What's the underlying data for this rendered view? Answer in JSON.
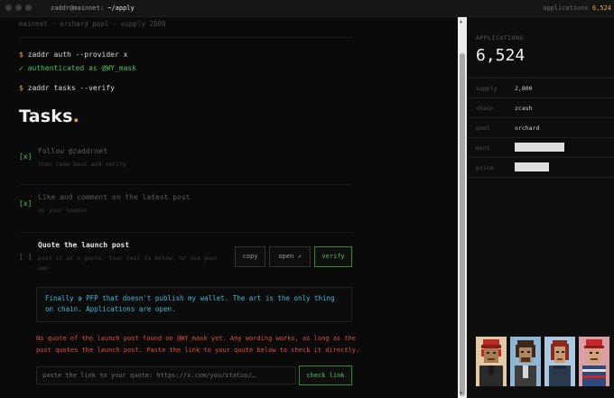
{
  "window": {
    "title_user": "zaddr@mainnet:",
    "title_path": "~/apply",
    "apps_label": "applications",
    "apps_count": "6,524"
  },
  "breadcrumb": "mainnet · orchard pool · supply 2800",
  "terminal": {
    "cmd1": "zaddr auth --provider x",
    "auth_ok": "✓ authenticated as @WY_mask",
    "cmd2": "zaddr tasks --verify",
    "prompt": "$"
  },
  "heading": {
    "text": "Tasks",
    "dot": "."
  },
  "tasks": [
    {
      "check": "[x]",
      "title": "Follow @zaddrnet",
      "sub": "then come back and verify"
    },
    {
      "check": "[x]",
      "title": "Like and comment on the latest post",
      "sub": "on your honour"
    },
    {
      "check": "[ ]",
      "title": "Quote the launch post",
      "sub": "post it as a quote. Your text is below, or use your own"
    }
  ],
  "buttons": {
    "copy": "copy",
    "open": "open ↗",
    "verify": "verify",
    "check_link": "check link"
  },
  "quote_text": "Finally a PFP that doesn't publish my wallet. The art is the only thing on chain. Applications are open.",
  "warning": "No quote of the launch post found on @WY_mask yet. Any wording works, as long as the post quotes the launch post. Paste the link to your quote below to check it directly.",
  "link_input": {
    "placeholder": "paste the link to your quote: https://x.com/you/status/…"
  },
  "stats": {
    "label": "APPLICATIONS",
    "value": "6,524",
    "rows": [
      {
        "key": "supply",
        "value": "2,800"
      },
      {
        "key": "chain",
        "value": "zcash"
      },
      {
        "key": "pool",
        "value": "orchard"
      },
      {
        "key": "mint",
        "bar_fraction": 0.55
      },
      {
        "key": "price",
        "bar_fraction": 0.38
      }
    ]
  },
  "colors": {
    "accent": "#e8a838",
    "success": "#4fbf5a",
    "quote": "#3fb8d8",
    "warning": "#e24b3b",
    "avatar_bg": [
      "#e2c9a6",
      "#8fb6d4",
      "#a9c9e0",
      "#d9a0a6"
    ]
  }
}
